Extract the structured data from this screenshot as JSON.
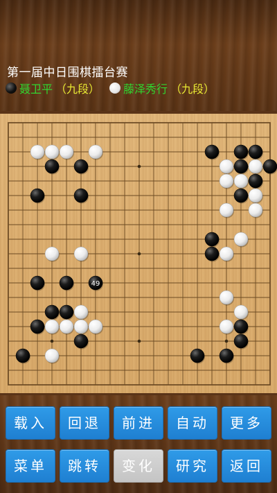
{
  "game": {
    "title": "第一届中日围棋擂台赛",
    "black_player": "聂卫平",
    "black_rank": "（九段）",
    "white_player": "藤泽秀行",
    "white_rank": "（九段）"
  },
  "board": {
    "size": 19,
    "last_move_number": "49",
    "star_points": [
      [
        3,
        3
      ],
      [
        9,
        3
      ],
      [
        15,
        3
      ],
      [
        3,
        9
      ],
      [
        9,
        9
      ],
      [
        15,
        9
      ],
      [
        3,
        15
      ],
      [
        9,
        15
      ],
      [
        15,
        15
      ]
    ],
    "stones": [
      {
        "c": "w",
        "x": 2,
        "y": 2
      },
      {
        "c": "w",
        "x": 3,
        "y": 2
      },
      {
        "c": "w",
        "x": 4,
        "y": 2
      },
      {
        "c": "w",
        "x": 6,
        "y": 2
      },
      {
        "c": "b",
        "x": 3,
        "y": 3
      },
      {
        "c": "b",
        "x": 5,
        "y": 3
      },
      {
        "c": "b",
        "x": 2,
        "y": 5
      },
      {
        "c": "b",
        "x": 5,
        "y": 5
      },
      {
        "c": "w",
        "x": 3,
        "y": 9
      },
      {
        "c": "w",
        "x": 5,
        "y": 9
      },
      {
        "c": "b",
        "x": 2,
        "y": 11
      },
      {
        "c": "b",
        "x": 4,
        "y": 11
      },
      {
        "c": "b",
        "x": 6,
        "y": 11,
        "n": "49"
      },
      {
        "c": "b",
        "x": 3,
        "y": 13
      },
      {
        "c": "b",
        "x": 4,
        "y": 13
      },
      {
        "c": "w",
        "x": 5,
        "y": 13
      },
      {
        "c": "b",
        "x": 2,
        "y": 14
      },
      {
        "c": "w",
        "x": 3,
        "y": 14
      },
      {
        "c": "w",
        "x": 4,
        "y": 14
      },
      {
        "c": "w",
        "x": 5,
        "y": 14
      },
      {
        "c": "w",
        "x": 6,
        "y": 14
      },
      {
        "c": "b",
        "x": 5,
        "y": 15
      },
      {
        "c": "b",
        "x": 1,
        "y": 16
      },
      {
        "c": "w",
        "x": 3,
        "y": 16
      },
      {
        "c": "b",
        "x": 14,
        "y": 2
      },
      {
        "c": "b",
        "x": 16,
        "y": 2
      },
      {
        "c": "b",
        "x": 17,
        "y": 2
      },
      {
        "c": "w",
        "x": 15,
        "y": 3
      },
      {
        "c": "b",
        "x": 16,
        "y": 3
      },
      {
        "c": "w",
        "x": 17,
        "y": 3
      },
      {
        "c": "b",
        "x": 18,
        "y": 3
      },
      {
        "c": "w",
        "x": 15,
        "y": 4
      },
      {
        "c": "w",
        "x": 16,
        "y": 4
      },
      {
        "c": "b",
        "x": 17,
        "y": 4
      },
      {
        "c": "b",
        "x": 16,
        "y": 5
      },
      {
        "c": "w",
        "x": 17,
        "y": 5
      },
      {
        "c": "w",
        "x": 15,
        "y": 6
      },
      {
        "c": "w",
        "x": 17,
        "y": 6
      },
      {
        "c": "b",
        "x": 14,
        "y": 8
      },
      {
        "c": "w",
        "x": 16,
        "y": 8
      },
      {
        "c": "b",
        "x": 14,
        "y": 9
      },
      {
        "c": "w",
        "x": 15,
        "y": 9
      },
      {
        "c": "w",
        "x": 15,
        "y": 12
      },
      {
        "c": "w",
        "x": 16,
        "y": 13
      },
      {
        "c": "w",
        "x": 15,
        "y": 14
      },
      {
        "c": "b",
        "x": 16,
        "y": 14
      },
      {
        "c": "b",
        "x": 16,
        "y": 15
      },
      {
        "c": "b",
        "x": 13,
        "y": 16
      },
      {
        "c": "b",
        "x": 15,
        "y": 16
      }
    ]
  },
  "buttons_row1": [
    {
      "name": "load-button",
      "label": "载入",
      "enabled": true
    },
    {
      "name": "back-button",
      "label": "回退",
      "enabled": true
    },
    {
      "name": "forward-button",
      "label": "前进",
      "enabled": true
    },
    {
      "name": "auto-button",
      "label": "自动",
      "enabled": true
    },
    {
      "name": "more-button",
      "label": "更多",
      "enabled": true
    }
  ],
  "buttons_row2": [
    {
      "name": "menu-button",
      "label": "菜单",
      "enabled": true
    },
    {
      "name": "jump-button",
      "label": "跳转",
      "enabled": true
    },
    {
      "name": "variation-button",
      "label": "变化",
      "enabled": false
    },
    {
      "name": "study-button",
      "label": "研究",
      "enabled": true
    },
    {
      "name": "return-button",
      "label": "返回",
      "enabled": true
    }
  ]
}
